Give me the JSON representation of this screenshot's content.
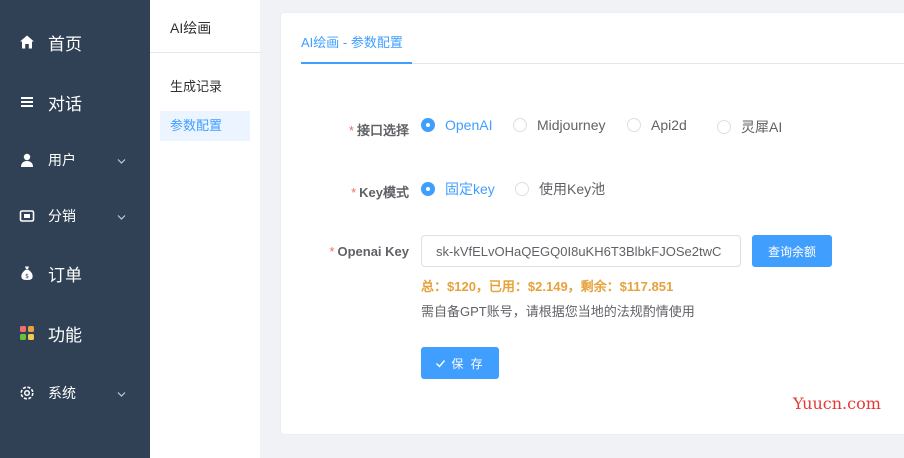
{
  "sidebar": {
    "items": [
      {
        "label": "首页",
        "icon": "home-icon"
      },
      {
        "label": "对话",
        "icon": "list-icon"
      },
      {
        "label": "用户",
        "icon": "user-icon",
        "expandable": true
      },
      {
        "label": "分销",
        "icon": "wallet-icon",
        "expandable": true
      },
      {
        "label": "订单",
        "icon": "money-bag-icon"
      },
      {
        "label": "功能",
        "icon": "apps-icon"
      },
      {
        "label": "系统",
        "icon": "gear-icon",
        "expandable": true
      }
    ]
  },
  "submenu": {
    "title": "AI绘画",
    "items": [
      {
        "label": "生成记录",
        "active": false
      },
      {
        "label": "参数配置",
        "active": true
      }
    ]
  },
  "tab": {
    "label": "AI绘画 - 参数配置"
  },
  "form": {
    "interface": {
      "label": "接口选择",
      "options": [
        "OpenAI",
        "Midjourney",
        "Api2d",
        "灵犀AI"
      ],
      "selected": "OpenAI"
    },
    "key_mode": {
      "label": "Key模式",
      "options": [
        "固定key",
        "使用Key池"
      ],
      "selected": "固定key"
    },
    "openai_key": {
      "label": "Openai Key",
      "value": "sk-kVfELvOHaQEGQ0I8uKH6T3BlbkFJOSe2twC",
      "query_button": "查询余额",
      "balance": "总：$120，已用：$2.149，剩余：$117.851",
      "hint": "需自备GPT账号，请根据您当地的法规酌情使用"
    },
    "save_button": "保 存"
  },
  "watermark": "Yuucn.com",
  "colors": {
    "sidebar_bg": "#304156",
    "primary": "#409eff",
    "required": "#f56c6c",
    "balance": "#e6a23c",
    "watermark": "#e53935"
  }
}
